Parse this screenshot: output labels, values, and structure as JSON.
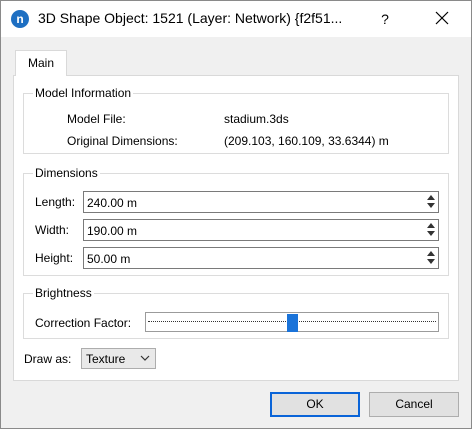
{
  "window": {
    "title": "3D Shape Object: 1521 (Layer: Network) {f2f51...",
    "app_icon_letter": "n",
    "help_label": "?"
  },
  "tabs": [
    {
      "label": "Main",
      "selected": true
    }
  ],
  "model_info": {
    "title": "Model Information",
    "model_file_label": "Model File:",
    "model_file_value": "stadium.3ds",
    "orig_dim_label": "Original Dimensions:",
    "orig_dim_value": "(209.103, 160.109, 33.6344) m"
  },
  "dimensions": {
    "title": "Dimensions",
    "length_label": "Length:",
    "length_value": "240.00 m",
    "width_label": "Width:",
    "width_value": "190.00 m",
    "height_label": "Height:",
    "height_value": "50.00 m"
  },
  "brightness": {
    "title": "Brightness",
    "correction_label": "Correction Factor:",
    "correction_value": 0.5
  },
  "draw_as": {
    "label": "Draw as:",
    "selected": "Texture"
  },
  "buttons": {
    "ok": "OK",
    "cancel": "Cancel"
  },
  "colors": {
    "accent": "#1a73d9",
    "app_icon": "#1e6fc2"
  }
}
